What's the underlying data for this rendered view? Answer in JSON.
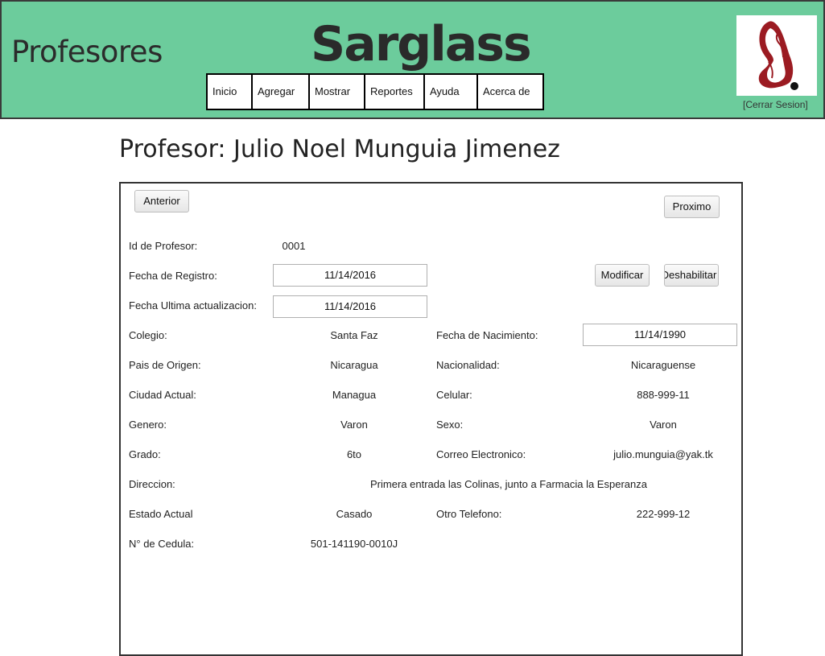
{
  "header": {
    "section_title": "Profesores",
    "brand": "Sarglass",
    "nav": [
      "Inicio",
      "Agregar",
      "Mostrar",
      "Reportes",
      "Ayuda",
      "Acerca de"
    ],
    "logout": "[Cerrar Sesion]",
    "colors": {
      "header_bg": "#6ccc9c",
      "logo_red": "#9b1b22"
    }
  },
  "page_title": "Profesor: Julio Noel Munguia Jimenez",
  "buttons": {
    "prev": "Anterior",
    "next": "Proximo",
    "modify": "Modificar",
    "disable": "Deshabilitar"
  },
  "fields": {
    "id_label": "Id de Profesor:",
    "id_value": "0001",
    "registro_label": "Fecha de Registro:",
    "registro_value": "11/14/2016",
    "actualizacion_label": "Fecha Ultima actualizacion:",
    "actualizacion_value": "11/14/2016",
    "colegio_label": "Colegio:",
    "colegio_value": "Santa Faz",
    "nacimiento_label": "Fecha de Nacimiento:",
    "nacimiento_value": "11/14/1990",
    "pais_label": "Pais de Origen:",
    "pais_value": "Nicaragua",
    "nacionalidad_label": "Nacionalidad:",
    "nacionalidad_value": "Nicaraguense",
    "ciudad_label": "Ciudad Actual:",
    "ciudad_value": "Managua",
    "celular_label": "Celular:",
    "celular_value": "888-999-11",
    "genero_label": "Genero:",
    "genero_value": "Varon",
    "sexo_label": "Sexo:",
    "sexo_value": "Varon",
    "grado_label": "Grado:",
    "grado_value": "6to",
    "correo_label": "Correo Electronico:",
    "correo_value": "julio.munguia@yak.tk",
    "direccion_label": "Direccion:",
    "direccion_value": "Primera entrada las Colinas, junto a Farmacia la Esperanza",
    "estado_label": "Estado Actual",
    "estado_value": "Casado",
    "otro_tel_label": "Otro Telefono:",
    "otro_tel_value": "222-999-12",
    "cedula_label": "N° de Cedula:",
    "cedula_value": "501-141190-0010J"
  }
}
